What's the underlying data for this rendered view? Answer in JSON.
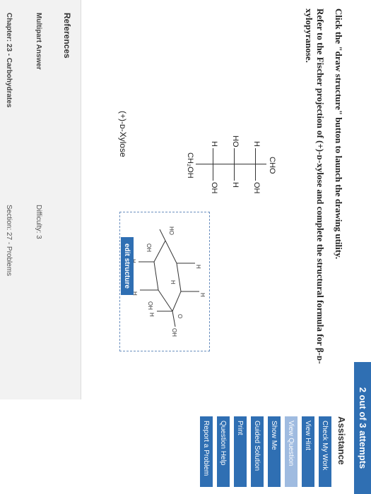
{
  "attempts": {
    "label": "2 out of 3 attempts"
  },
  "question": {
    "instruction": "Click the \"draw structure\" button to launch the drawing utility.",
    "prompt": "Refer to the Fischer projection of (+)-ᴅ-xylose and complete the structural formula for β-ᴅ-xylopyranose."
  },
  "fischer": {
    "top_group": "CHO",
    "rows": [
      {
        "left": "H",
        "right": "OH"
      },
      {
        "left": "HO",
        "right": "H"
      },
      {
        "left": "H",
        "right": "OH"
      }
    ],
    "bottom_group": "CH₂OH",
    "compound_name": "(+)-ᴅ-Xylose"
  },
  "structure": {
    "atom_labels": [
      "HO",
      "OH",
      "H",
      "H",
      "H",
      "H",
      "O",
      "H",
      "OH",
      "OH",
      "H"
    ],
    "edit_button_label": "edit structure"
  },
  "references": {
    "title": "References",
    "answer_type": "Multipart Answer",
    "difficulty": "Difficulty: 3",
    "chapter": "Chapter: 23 - Carbohydrates",
    "section": "Section: 27 - Problems"
  },
  "assistance": {
    "title": "Assistance",
    "buttons": [
      {
        "label": "Check My Work",
        "enabled": true
      },
      {
        "label": "View Hint",
        "enabled": true
      },
      {
        "label": "View Question",
        "enabled": false
      },
      {
        "label": "Show Me",
        "enabled": true
      },
      {
        "label": "Guided Solution",
        "enabled": true
      },
      {
        "label": "Print",
        "enabled": true
      },
      {
        "label": "Question Help",
        "enabled": true
      },
      {
        "label": "Report a Problem",
        "enabled": true
      }
    ]
  },
  "colors": {
    "accent": "#2f6fb3",
    "disabled": "#9fbbe0",
    "panel": "#f2f2f2"
  }
}
